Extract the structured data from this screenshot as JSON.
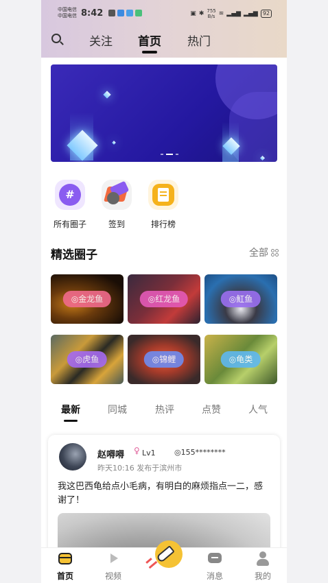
{
  "status": {
    "carrier1": "中国电信",
    "carrier2": "中国电信",
    "time": "8:42",
    "net_speed_value": "755",
    "net_speed_unit": "B/s",
    "battery": "92"
  },
  "nav": {
    "follow": "关注",
    "home": "首页",
    "hot": "热门"
  },
  "shortcuts": [
    {
      "label": "所有圈子",
      "icon": "hash-icon",
      "color": "#8a5cf0"
    },
    {
      "label": "签到",
      "icon": "checkin-icon",
      "color": "#f26a3f"
    },
    {
      "label": "排行榜",
      "icon": "ranking-icon",
      "color": "#f5b21c"
    }
  ],
  "featured": {
    "title": "精选圈子",
    "all": "全部",
    "circles": [
      {
        "label": "◎金龙鱼",
        "color": "#f06a8c"
      },
      {
        "label": "◎红龙鱼",
        "color": "#e45ab8"
      },
      {
        "label": "◎魟鱼",
        "color": "#9a6ff0"
      },
      {
        "label": "◎虎鱼",
        "color": "#a56af0"
      },
      {
        "label": "◎锦鲤",
        "color": "#6f8cf0"
      },
      {
        "label": "◎龟类",
        "color": "#5fb8f0"
      }
    ]
  },
  "feed_tabs": [
    "最新",
    "同城",
    "热评",
    "点赞",
    "人气"
  ],
  "post": {
    "username": "赵嘚嘚",
    "gender_symbol": "♀",
    "level": "Lv1",
    "phone": "◎155********",
    "meta": "昨天10:16 发布于滨州市",
    "text": "我这巴西龟给点小毛病，有明白的麻烦指点一二，感谢了！"
  },
  "tabbar": {
    "home": "首页",
    "video": "视频",
    "messages": "消息",
    "mine": "我的"
  }
}
